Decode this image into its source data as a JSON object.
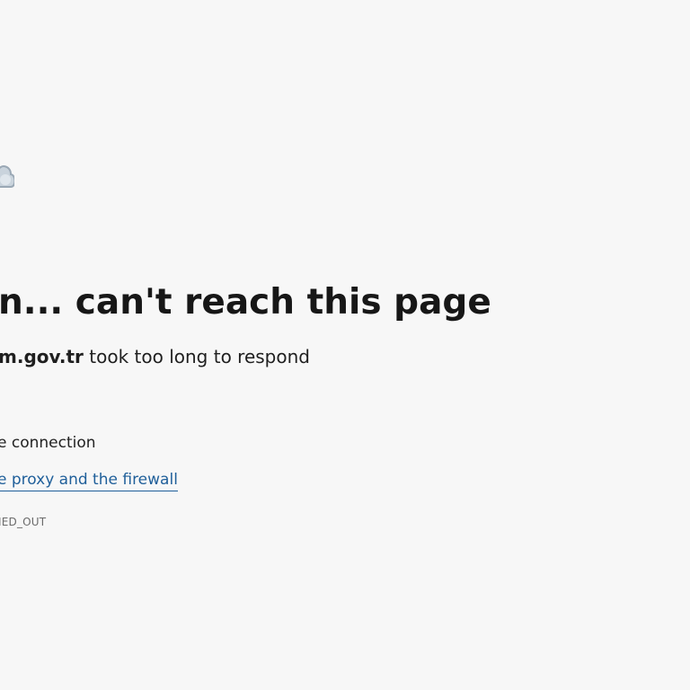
{
  "error_page": {
    "icon": "cloud-error-icon",
    "headline": "n... can't reach this page",
    "host": "m.gov.tr",
    "message": " took too long to respond",
    "suggestion": "e connection",
    "link_text": "e proxy and the firewall",
    "error_code": "IED_OUT"
  },
  "colors": {
    "background": "#f7f7f7",
    "link": "#1f5f9a",
    "text": "#171717",
    "muted": "#6b6b6b"
  }
}
